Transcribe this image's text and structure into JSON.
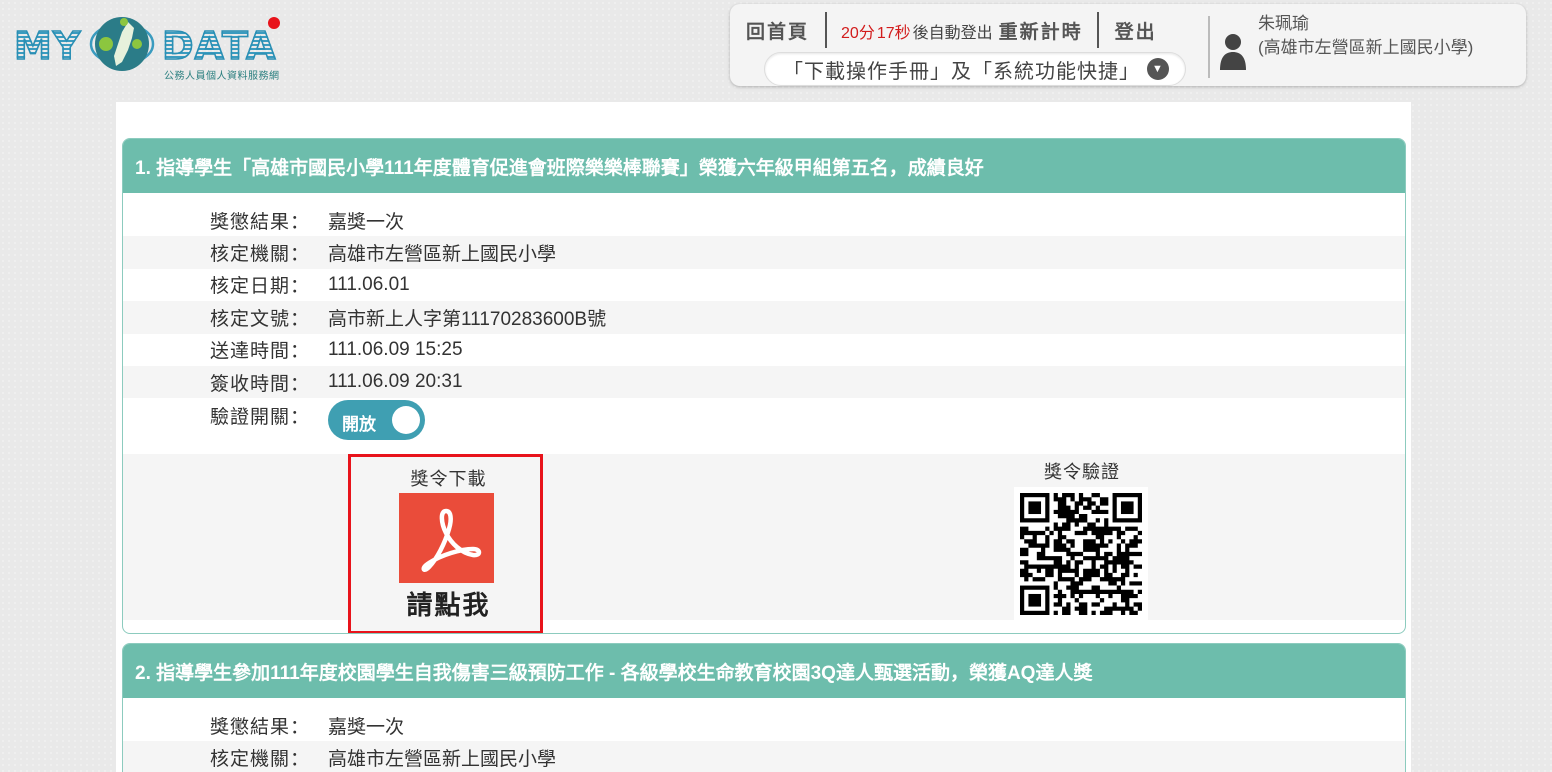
{
  "logo": {
    "left": "MY",
    "right": "DATA",
    "subtitle": "公務人員個人資料服務網"
  },
  "header": {
    "home_label": "回首頁",
    "timer_minutes": "20分",
    "timer_seconds": "17秒",
    "timer_suffix": "後自動登出",
    "restart_label": "重新計時",
    "logout_label": "登出",
    "manual_select": "「下載操作手冊」及「系統功能快捷」"
  },
  "user": {
    "name": "朱珮瑜",
    "org": "(高雄市左營區新上國民小學)"
  },
  "cards": [
    {
      "title": "1. 指導學生「高雄市國民小學111年度體育促進會班際樂樂棒聯賽」榮獲六年級甲組第五名，成績良好",
      "fields": [
        {
          "label": "獎懲結果：",
          "value": "嘉獎一次"
        },
        {
          "label": "核定機關：",
          "value": "高雄市左營區新上國民小學"
        },
        {
          "label": "核定日期：",
          "value": "111.06.01"
        },
        {
          "label": "核定文號：",
          "value": "高市新上人字第11170283600B號"
        },
        {
          "label": "送達時間：",
          "value": "111.06.09 15:25"
        },
        {
          "label": "簽收時間：",
          "value": "111.06.09 20:31"
        }
      ],
      "verify_switch_label": "驗證開關：",
      "verify_switch_state": "開放",
      "download_title": "獎令下載",
      "download_click": "請點我",
      "verify_title": "獎令驗證"
    },
    {
      "title": "2. 指導學生參加111年度校園學生自我傷害三級預防工作 - 各級學校生命教育校園3Q達人甄選活動，榮獲AQ達人獎",
      "fields": [
        {
          "label": "獎懲結果：",
          "value": "嘉獎一次"
        },
        {
          "label": "核定機關：",
          "value": "高雄市左營區新上國民小學"
        }
      ]
    }
  ],
  "colors": {
    "card_header": "#6dbdac",
    "toggle": "#3f9fb2",
    "pdf": "#ea4c3a",
    "highlight_border": "#e8131b",
    "timer": "#d21c1c"
  },
  "icons": {
    "pdf": "adobe-pdf-icon",
    "user": "user-silhouette-icon",
    "chevron": "chevron-down-icon",
    "globe": "taiwan-globe-logo"
  }
}
